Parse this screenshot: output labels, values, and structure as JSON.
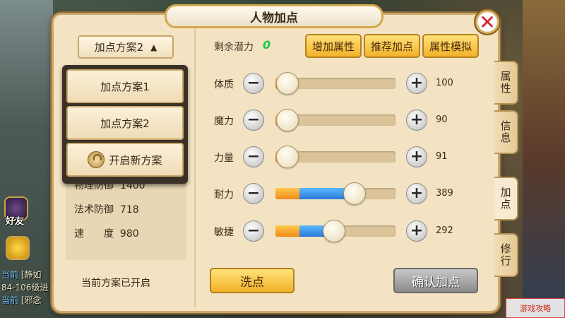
{
  "title": "人物加点",
  "scheme_select": {
    "label": "加点方案2"
  },
  "dropdown": {
    "items": [
      "加点方案1",
      "加点方案2",
      "开启新方案"
    ]
  },
  "stats": [
    {
      "label": "物理防御",
      "value": "1400"
    },
    {
      "label": "法术防御",
      "value": "718"
    },
    {
      "label": "速　　度",
      "value": "980"
    }
  ],
  "current_scheme_status": "当前方案已开启",
  "potential": {
    "label": "剩余潜力",
    "value": "0"
  },
  "top_buttons": [
    "增加属性",
    "推荐加点",
    "属性模拟"
  ],
  "attributes": [
    {
      "label": "体质",
      "value": "100",
      "base_fraction": 0.1,
      "added_fraction": 0.0
    },
    {
      "label": "魔力",
      "value": "90",
      "base_fraction": 0.1,
      "added_fraction": 0.0
    },
    {
      "label": "力量",
      "value": "91",
      "base_fraction": 0.1,
      "added_fraction": 0.0
    },
    {
      "label": "耐力",
      "value": "389",
      "base_fraction": 0.2,
      "added_fraction": 0.46
    },
    {
      "label": "敏捷",
      "value": "292",
      "base_fraction": 0.2,
      "added_fraction": 0.29
    }
  ],
  "bottom_buttons": {
    "wash": "洗点",
    "confirm": "确认加点"
  },
  "side_tabs": [
    "属性",
    "信息",
    "加点",
    "修行"
  ],
  "hud": {
    "friends_label": "好友",
    "chat_lines": [
      {
        "tag": "当前",
        "text": "[静如"
      },
      {
        "tag": "",
        "text": "84-106级进"
      },
      {
        "tag": "当前",
        "text": "[邪念"
      }
    ]
  },
  "watermark": "游戏攻略",
  "colors": {
    "potential_value": "#1ac84a",
    "fill_orange": "#f08a1a",
    "fill_blue": "#2a7ad8"
  }
}
